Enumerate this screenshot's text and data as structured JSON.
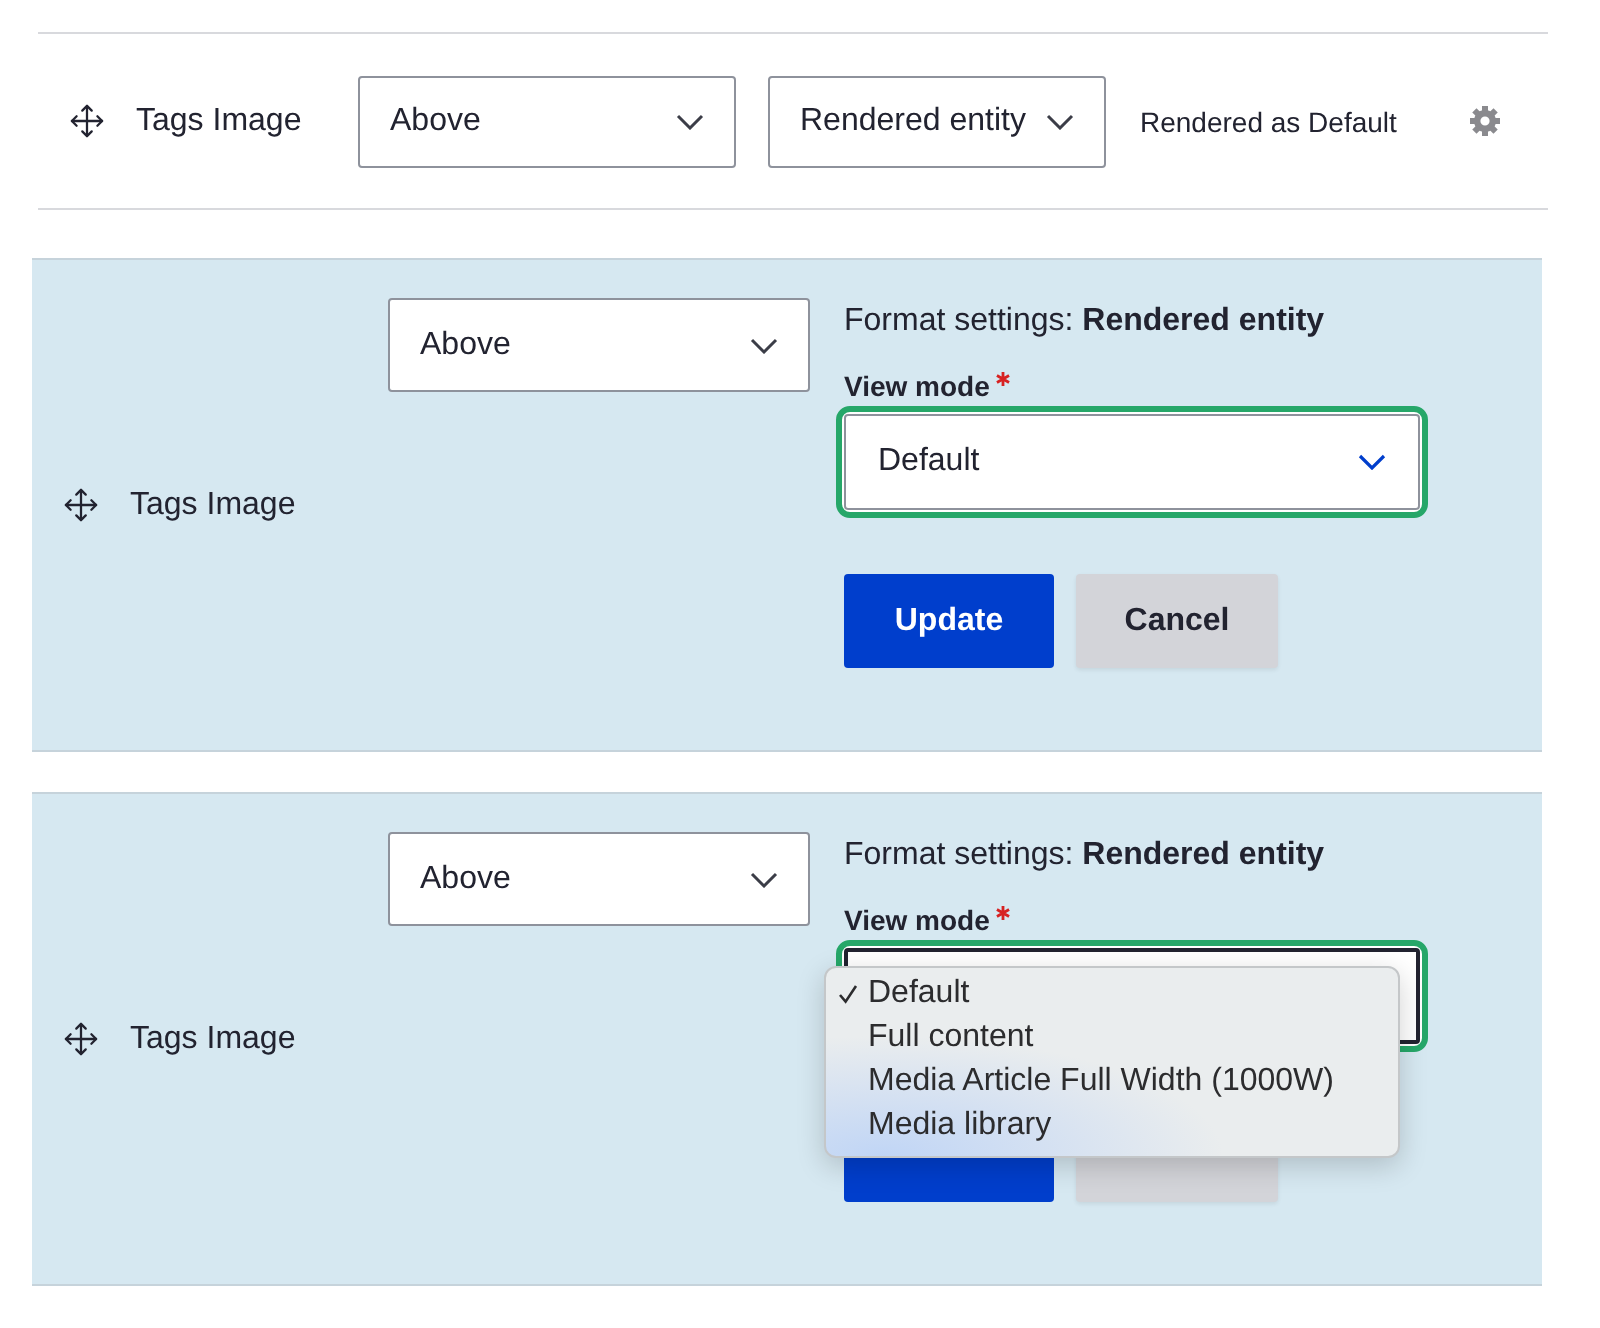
{
  "rows": [
    {
      "kind": "summary",
      "label": "Tags Image",
      "label_display": {
        "value": "Above"
      },
      "formatter": {
        "value": "Rendered entity"
      },
      "summary": "Rendered as Default"
    },
    {
      "kind": "edit",
      "label": "Tags Image",
      "label_display": {
        "value": "Above"
      },
      "settings_title": "Format settings: **Rendered entity**",
      "view_mode": {
        "label": "View mode",
        "required": true,
        "value": "Default",
        "focused": true,
        "open": false
      },
      "buttons": [
        {
          "kind": "primary",
          "label": "Update"
        },
        {
          "kind": "secondary",
          "label": "Cancel"
        }
      ]
    },
    {
      "kind": "edit",
      "label": "Tags Image",
      "label_display": {
        "value": "Above"
      },
      "settings_title": "Format settings: **Rendered entity**",
      "view_mode": {
        "label": "View mode",
        "required": true,
        "focused": true,
        "open": true,
        "options": [
          {
            "label": "Default",
            "selected": true
          },
          {
            "label": "Full content",
            "selected": false
          },
          {
            "label": "Media Article Full Width (1000W)",
            "selected": false
          },
          {
            "label": "Media library",
            "selected": false
          }
        ]
      },
      "buttons": [
        {
          "kind": "primary"
        },
        {
          "kind": "secondary"
        }
      ]
    }
  ]
}
